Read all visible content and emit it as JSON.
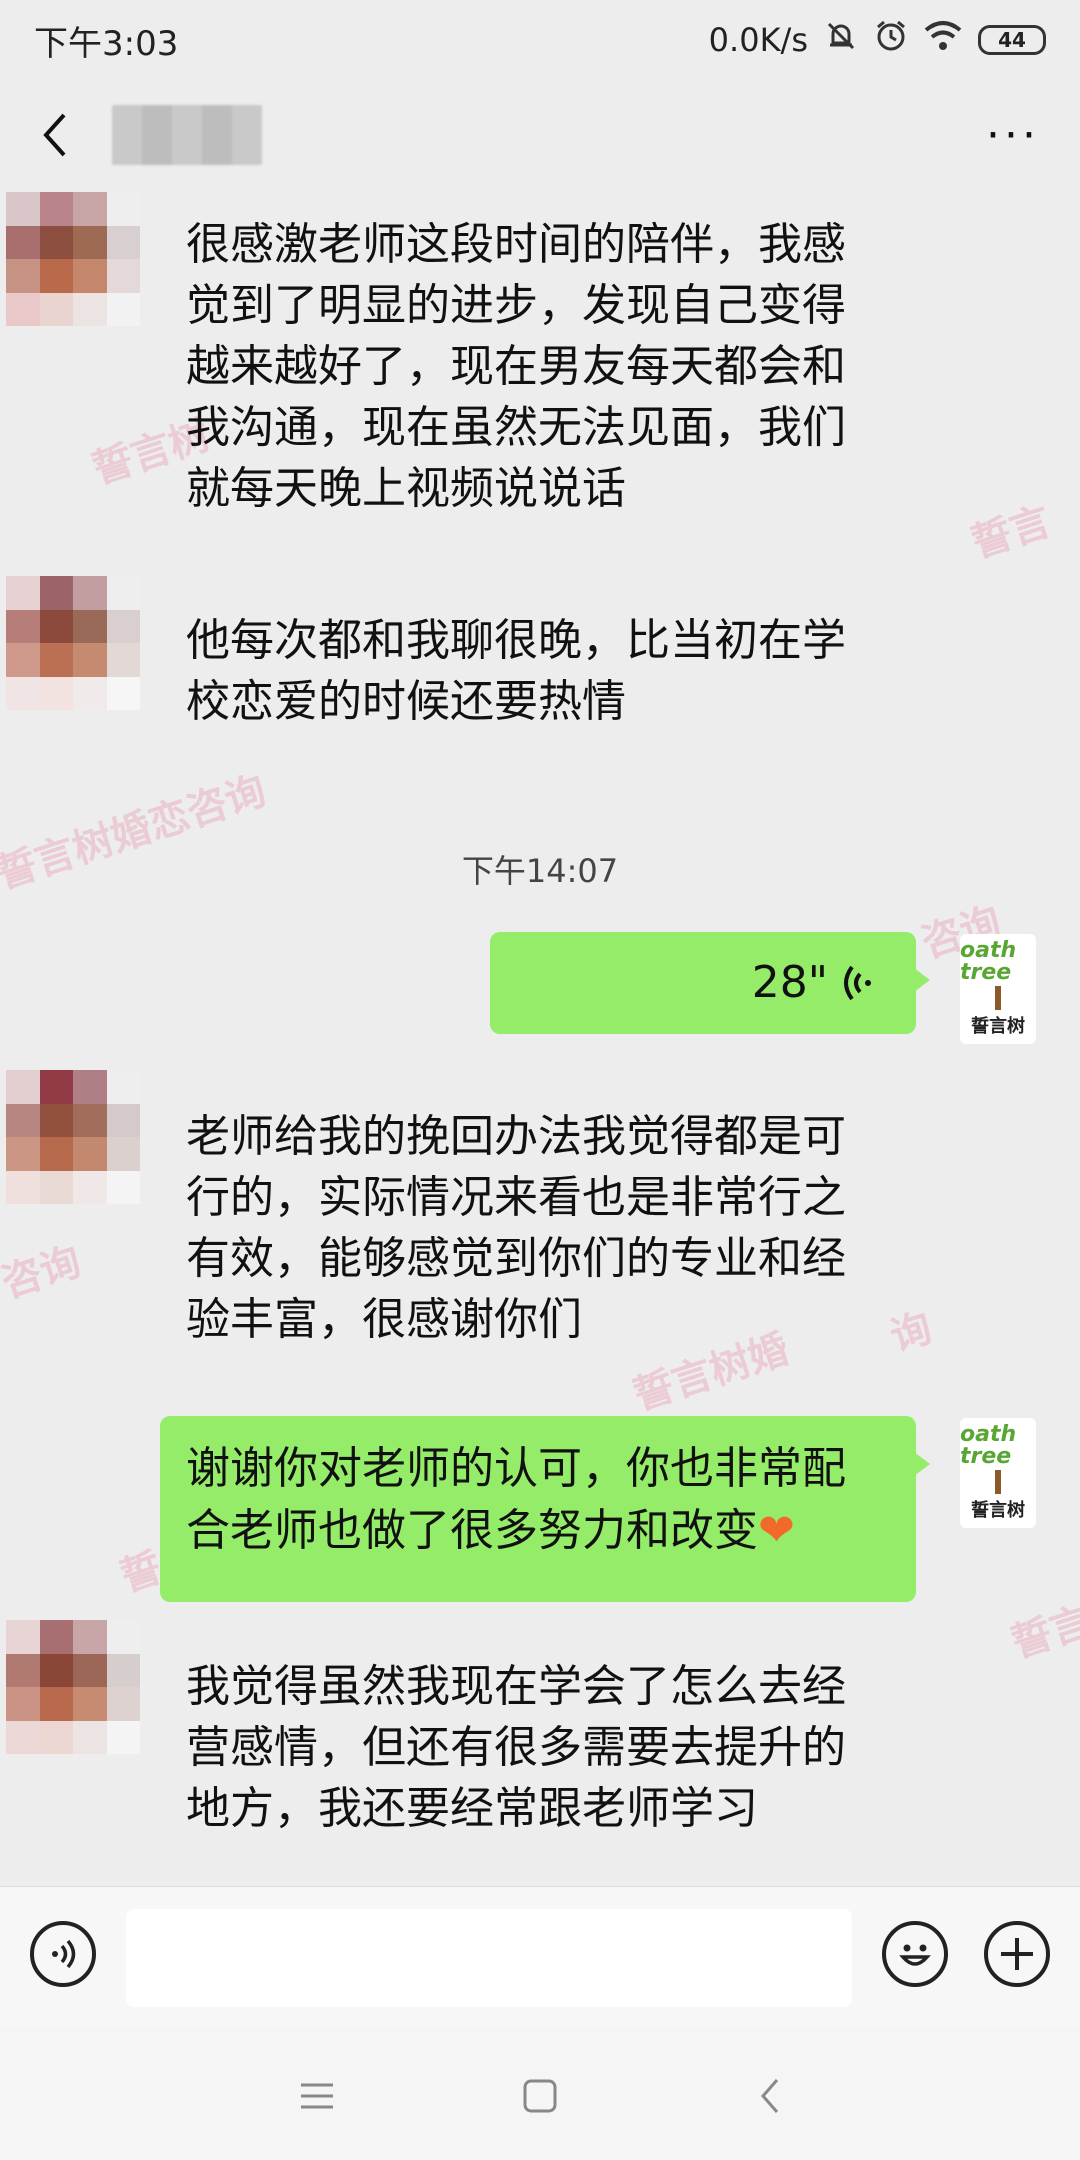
{
  "status_bar": {
    "time": "下午3:03",
    "network_speed": "0.0K/s",
    "battery": "44",
    "icons": [
      "mute-bell-icon",
      "alarm-icon",
      "wifi-icon",
      "battery-icon"
    ]
  },
  "header": {
    "title": "",
    "back_icon": "chevron-left-icon",
    "more_icon": "more-dots-icon",
    "more_label": "···"
  },
  "messages": [
    {
      "side": "left",
      "lines": [
        "很感激老师这段时间的陪伴，我感",
        "觉到了明显的进步，发现自己变得",
        "越来越好了，现在男友每天都会和",
        "我沟通，现在虽然无法见面，我们",
        "就每天晚上视频说说话"
      ]
    },
    {
      "side": "left",
      "lines": [
        "他每次都和我聊很晚，比当初在学",
        "校恋爱的时候还要热情"
      ]
    },
    {
      "side": "timestamp",
      "text": "下午14:07"
    },
    {
      "side": "right",
      "type": "voice",
      "duration": "28\""
    },
    {
      "side": "left",
      "lines": [
        "老师给我的挽回办法我觉得都是可",
        "行的，实际情况来看也是非常行之",
        "有效，能够感觉到你们的专业和经",
        "验丰富，很感谢你们"
      ]
    },
    {
      "side": "right",
      "lines": [
        "谢谢你对老师的认可，你也非常配",
        "合老师也做了很多努力和改变"
      ],
      "emoji": "❤"
    },
    {
      "side": "left",
      "lines": [
        "我觉得虽然我现在学会了怎么去经",
        "营感情，但还有很多需要去提升的",
        "地方，我还要经常跟老师学习"
      ]
    }
  ],
  "brand_avatar": {
    "top": "oath tree",
    "name": "誓言树",
    "mark": "®"
  },
  "watermark": {
    "full": "誓言树婚恋咨询",
    "brand": "誓言树",
    "fragment_a": "咨询",
    "fragment_b": "誓言树婚",
    "fragment_c": "询",
    "fragment_d": "誓",
    "fragment_e": "誓言"
  },
  "input_bar": {
    "placeholder": "",
    "voice_icon": "voice-input-icon",
    "emoji_icon": "emoji-icon",
    "plus_icon": "plus-icon"
  },
  "nav_bar": {
    "icons": [
      "menu-icon",
      "home-icon",
      "back-icon"
    ]
  },
  "colors": {
    "background": "#ededed",
    "bubble_green": "#95ec69",
    "emoji_heart": "#f26a2a",
    "watermark": "#e678a0"
  }
}
